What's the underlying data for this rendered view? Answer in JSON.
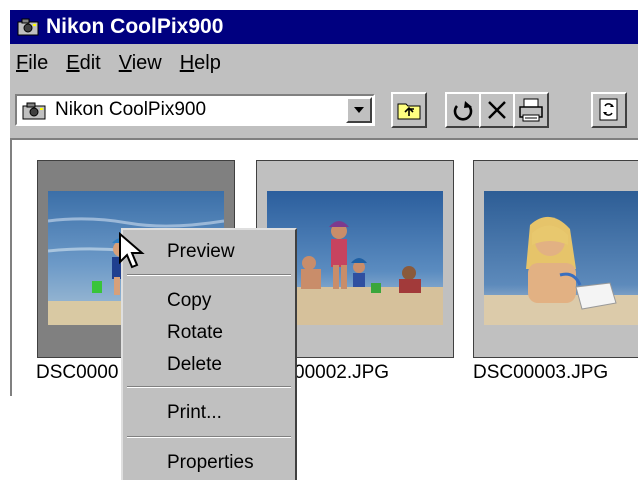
{
  "window": {
    "title": "Nikon CoolPix900"
  },
  "menubar": {
    "items": [
      {
        "key": "F",
        "rest": "ile"
      },
      {
        "key": "E",
        "rest": "dit"
      },
      {
        "key": "V",
        "rest": "iew"
      },
      {
        "key": "H",
        "rest": "elp"
      }
    ]
  },
  "toolbar": {
    "source_value": "Nikon CoolPix900",
    "icons": [
      "up-folder-icon",
      "rotate-icon",
      "delete-icon",
      "print-icon",
      "properties-icon"
    ]
  },
  "thumbnails": [
    {
      "caption": "DSC00001.JPG",
      "selected": true
    },
    {
      "caption": "DSC00002.JPG",
      "selected": false
    },
    {
      "caption": "DSC00003.JPG",
      "selected": false
    }
  ],
  "visible_captions": [
    "DSC0000",
    "00002.JPG",
    "DSC00003.JPG"
  ],
  "context_menu": {
    "items": [
      "Preview",
      "Copy",
      "Rotate",
      "Delete",
      "Print...",
      "Properties"
    ]
  },
  "colors": {
    "title_bar": "#000080",
    "face": "#c0c0c0",
    "selected_thumb": "#808080"
  }
}
